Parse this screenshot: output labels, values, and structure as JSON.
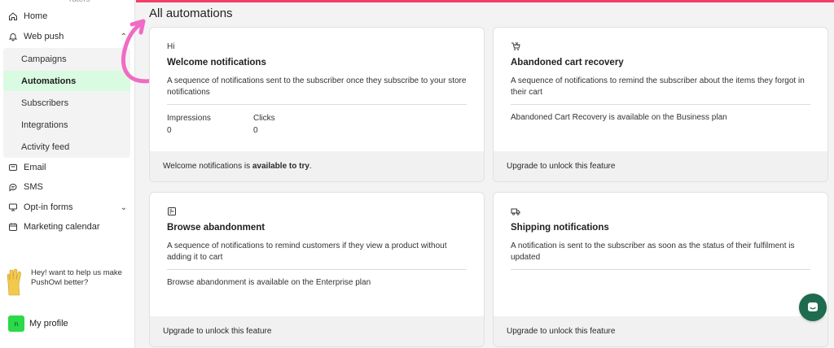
{
  "sidebar": {
    "cut_top_text": "raters",
    "home": "Home",
    "web_push": "Web push",
    "sub_items": [
      "Campaigns",
      "Automations",
      "Subscribers",
      "Integrations",
      "Activity feed"
    ],
    "email": "Email",
    "sms": "SMS",
    "optin": "Opt-in forms",
    "calendar": "Marketing calendar",
    "promo": "Hey! want to help us make PushOwl better?",
    "profile_initial": "n",
    "profile_label": "My profile"
  },
  "main": {
    "title": "All automations",
    "cards": [
      {
        "icon_text": "Hi",
        "title": "Welcome notifications",
        "description": "A sequence of notifications sent to the subscriber once they subscribe to your store notifications",
        "stats": [
          {
            "label": "Impressions",
            "value": "0"
          },
          {
            "label": "Clicks",
            "value": "0"
          }
        ],
        "footer_prefix": "Welcome notifications is ",
        "footer_bold": "available to try",
        "footer_suffix": "."
      },
      {
        "icon": "cart-icon",
        "title": "Abandoned cart recovery",
        "description": "A sequence of notifications to remind the subscriber about the items they forgot in their cart",
        "note": "Abandoned Cart Recovery is available on the Business plan",
        "footer": "Upgrade to unlock this feature"
      },
      {
        "icon": "browse-icon",
        "title": "Browse abandonment",
        "description": "A sequence of notifications to remind customers if they view a product without adding it to cart",
        "note": "Browse abandonment is available on the Enterprise plan",
        "footer": "Upgrade to unlock this feature"
      },
      {
        "icon": "truck-icon",
        "title": "Shipping notifications",
        "description": "A notification is sent to the subscriber as soon as the status of their fulfilment is updated",
        "footer": "Upgrade to unlock this feature"
      }
    ]
  },
  "colors": {
    "accent_bar": "#f43f6b",
    "active_item": "#d9fbe1",
    "chat_button": "#1e6b4f",
    "arrow": "#f06bc4"
  }
}
